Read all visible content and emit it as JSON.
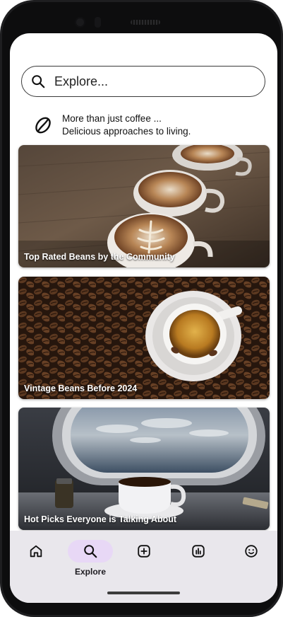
{
  "search": {
    "placeholder": "Explore..."
  },
  "tagline": {
    "line1": "More than just coffee ...",
    "line2": "Delicious approaches to living."
  },
  "cards": [
    {
      "label": "Top Rated Beans by the Community"
    },
    {
      "label": "Vintage Beans Before 2024"
    },
    {
      "label": "Hot Picks Everyone is Talking About"
    }
  ],
  "nav": {
    "items": [
      {
        "icon": "home-icon",
        "label": ""
      },
      {
        "icon": "search-icon",
        "label": "Explore",
        "active": true
      },
      {
        "icon": "add-box-icon",
        "label": ""
      },
      {
        "icon": "bar-chart-icon",
        "label": ""
      },
      {
        "icon": "smiley-icon",
        "label": ""
      }
    ]
  },
  "colors": {
    "nav_active_pill": "#e8d8f6",
    "nav_background": "#e9e7ec"
  }
}
